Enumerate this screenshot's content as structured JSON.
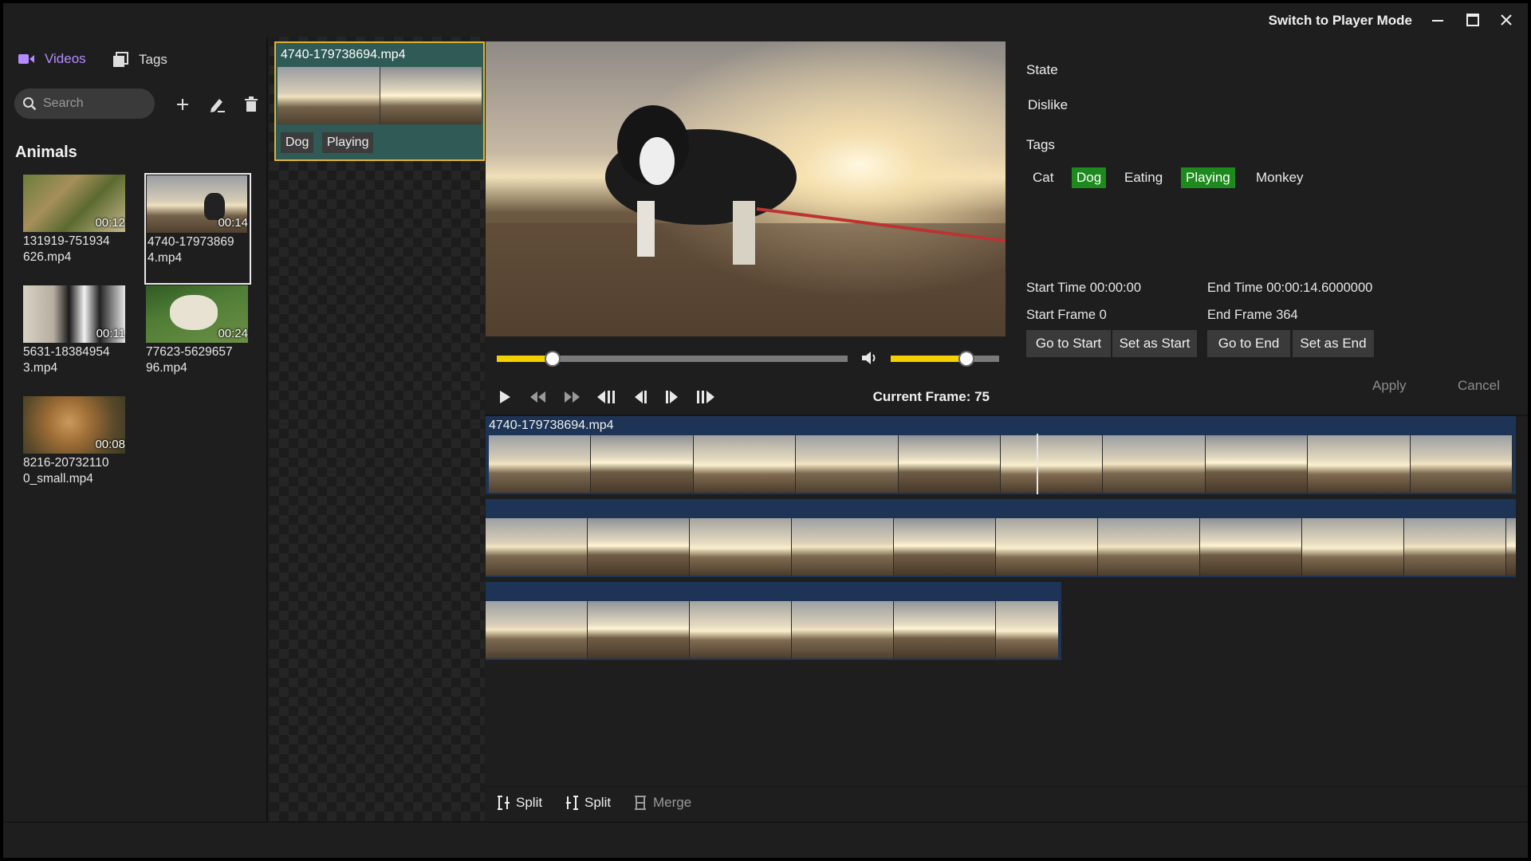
{
  "titlebar": {
    "player_mode_label": "Switch to Player Mode"
  },
  "sidebar": {
    "tabs": [
      {
        "label": "Videos",
        "icon": "video-camera-icon",
        "active": true
      },
      {
        "label": "Tags",
        "icon": "tags-stack-icon",
        "active": false
      }
    ],
    "search_placeholder": "Search",
    "section_title": "Animals",
    "videos": [
      {
        "name": "131919-751934626.mp4",
        "name_lines": [
          "131919-751934",
          "626.mp4"
        ],
        "duration": "00:12",
        "selected": false
      },
      {
        "name": "4740-179738694.mp4",
        "name_lines": [
          "4740-17973869",
          "4.mp4"
        ],
        "duration": "00:14",
        "selected": true
      },
      {
        "name": "5631-183849543.mp4",
        "name_lines": [
          "5631-18384954",
          "3.mp4"
        ],
        "duration": "00:11",
        "selected": false
      },
      {
        "name": "77623-562965796.mp4",
        "name_lines": [
          "77623-5629657",
          "96.mp4"
        ],
        "duration": "00:24",
        "selected": false
      },
      {
        "name": "8216-207321100_small.mp4",
        "name_lines": [
          "8216-20732110",
          "0_small.mp4"
        ],
        "duration": "00:08",
        "selected": false
      }
    ]
  },
  "clip": {
    "title": "4740-179738694.mp4",
    "tags": [
      "Dog",
      "Playing"
    ]
  },
  "player": {
    "current_frame_label": "Current Frame: 75",
    "progress": 0.16,
    "volume": 0.7
  },
  "props": {
    "state_label": "State",
    "state_value": "Dislike",
    "tags_label": "Tags",
    "tags": [
      {
        "label": "Cat",
        "on": false
      },
      {
        "label": "Dog",
        "on": true
      },
      {
        "label": "Eating",
        "on": false
      },
      {
        "label": "Playing",
        "on": true
      },
      {
        "label": "Monkey",
        "on": false
      }
    ],
    "start_time": "Start Time 00:00:00",
    "end_time": "End Time 00:00:14.6000000",
    "start_frame": "Start Frame 0",
    "end_frame": "End Frame 364",
    "go_to_start": "Go to Start",
    "set_as_start": "Set as Start",
    "go_to_end": "Go to End",
    "set_as_end": "Set as End",
    "apply": "Apply",
    "cancel": "Cancel"
  },
  "timeline": {
    "row1_label": "4740-179738694.mp4"
  },
  "bottom_tools": {
    "split1": "Split",
    "split2": "Split",
    "merge": "Merge"
  },
  "colors": {
    "accent_purple": "#b48cff",
    "clip_border": "#e0b232",
    "clip_bg": "#2f5a55",
    "tag_on": "#1d8a1d",
    "timeline_row": "#1d3457",
    "slider_fill": "#f5d000"
  }
}
